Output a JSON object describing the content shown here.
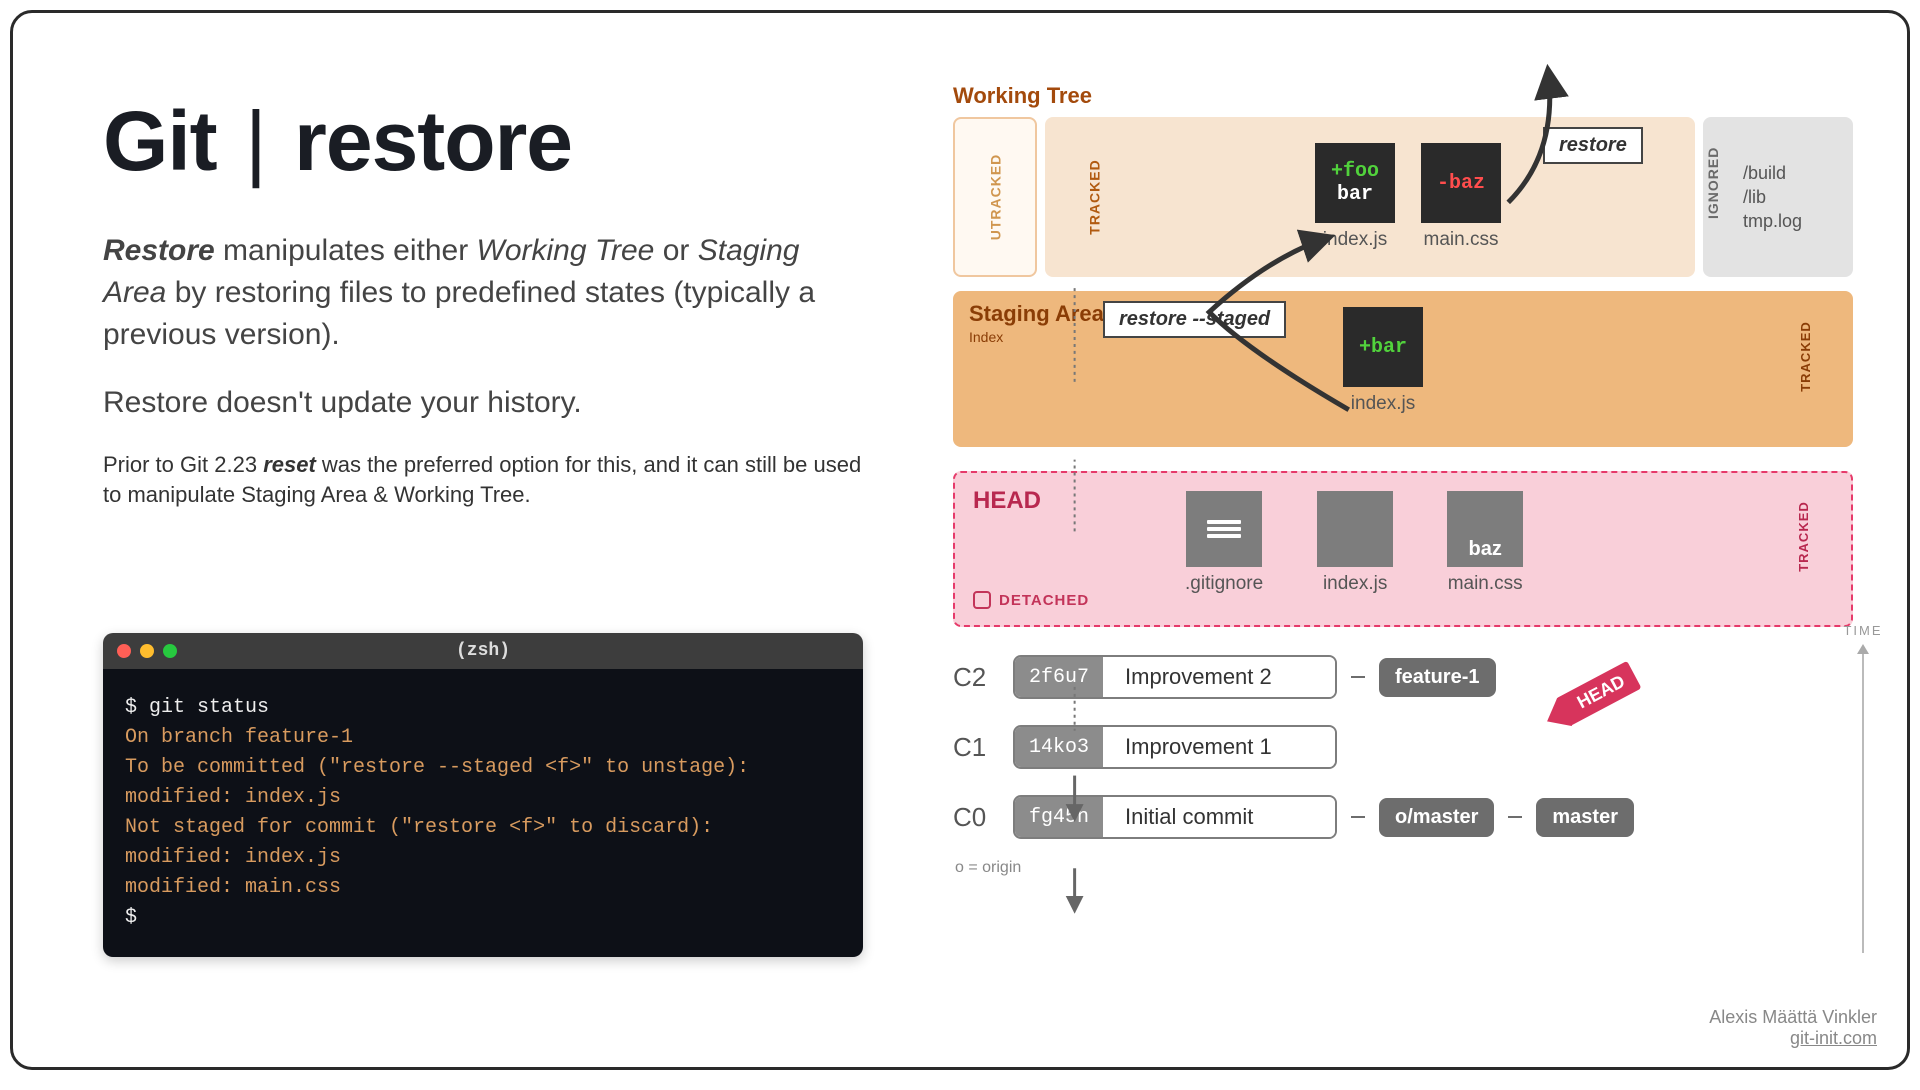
{
  "title": {
    "left": "Git",
    "sep": "|",
    "right": "restore"
  },
  "para1": "<b>Restore</b> manipulates either <i>Working Tree</i> or <i>Staging Area</i> by restoring files to predefined states (typically a previous version).",
  "para2": "Restore doesn't update your history.",
  "para3": "Prior to Git 2.23 <b>reset</b> was the preferred option for this, and it can still be used to manipulate Staging Area & Working Tree.",
  "terminal": {
    "title": "(zsh)",
    "lines": [
      {
        "cls": "white",
        "text": "$ git status"
      },
      {
        "cls": "orange",
        "text": "On branch feature-1"
      },
      {
        "cls": "orange",
        "text": "To be committed (\"restore --staged <f>\" to unstage):"
      },
      {
        "cls": "orange",
        "text": "    modified: index.js"
      },
      {
        "cls": "orange",
        "text": "Not staged for commit (\"restore <f>\" to discard):"
      },
      {
        "cls": "orange",
        "text": "    modified: index.js"
      },
      {
        "cls": "orange",
        "text": "    modified: main.css"
      },
      {
        "cls": "white",
        "text": "$"
      }
    ]
  },
  "workingTree": {
    "label": "Working Tree",
    "utracked": "UTRACKED",
    "tracked": "TRACKED",
    "files": [
      {
        "name": "index.js",
        "diff": [
          {
            "sign": "+",
            "text": "foo"
          },
          {
            "sign": "",
            "text": "bar"
          }
        ]
      },
      {
        "name": "main.css",
        "diff": [
          {
            "sign": "-",
            "text": "baz"
          }
        ]
      }
    ],
    "ignored": {
      "label": "IGNORED",
      "items": [
        "/build",
        "/lib",
        "tmp.log"
      ]
    }
  },
  "staging": {
    "label": "Staging Area",
    "sub": "Index",
    "tracked": "TRACKED",
    "file": {
      "name": "index.js",
      "diff": [
        {
          "sign": "+",
          "text": "bar"
        }
      ]
    }
  },
  "head": {
    "label": "HEAD",
    "detached": "DETACHED",
    "tracked": "TRACKED",
    "files": [
      {
        "name": ".gitignore",
        "content": "bars"
      },
      {
        "name": "index.js",
        "content": ""
      },
      {
        "name": "main.css",
        "content": "baz"
      }
    ]
  },
  "callouts": {
    "restoreStaged": "restore --staged",
    "restore": "restore",
    "headTag": "HEAD"
  },
  "commits": [
    {
      "id": "C2",
      "hash": "2f6u7",
      "msg": "Improvement 2",
      "tags": [
        "feature-1"
      ]
    },
    {
      "id": "C1",
      "hash": "14ko3",
      "msg": "Improvement 1",
      "tags": []
    },
    {
      "id": "C0",
      "hash": "fg45n",
      "msg": "Initial commit",
      "tags": [
        "o/master",
        "master"
      ]
    }
  ],
  "originNote": "o = origin",
  "time": "TIME",
  "credits": {
    "author": "Alexis Määttä Vinkler",
    "site": "git-init.com"
  }
}
